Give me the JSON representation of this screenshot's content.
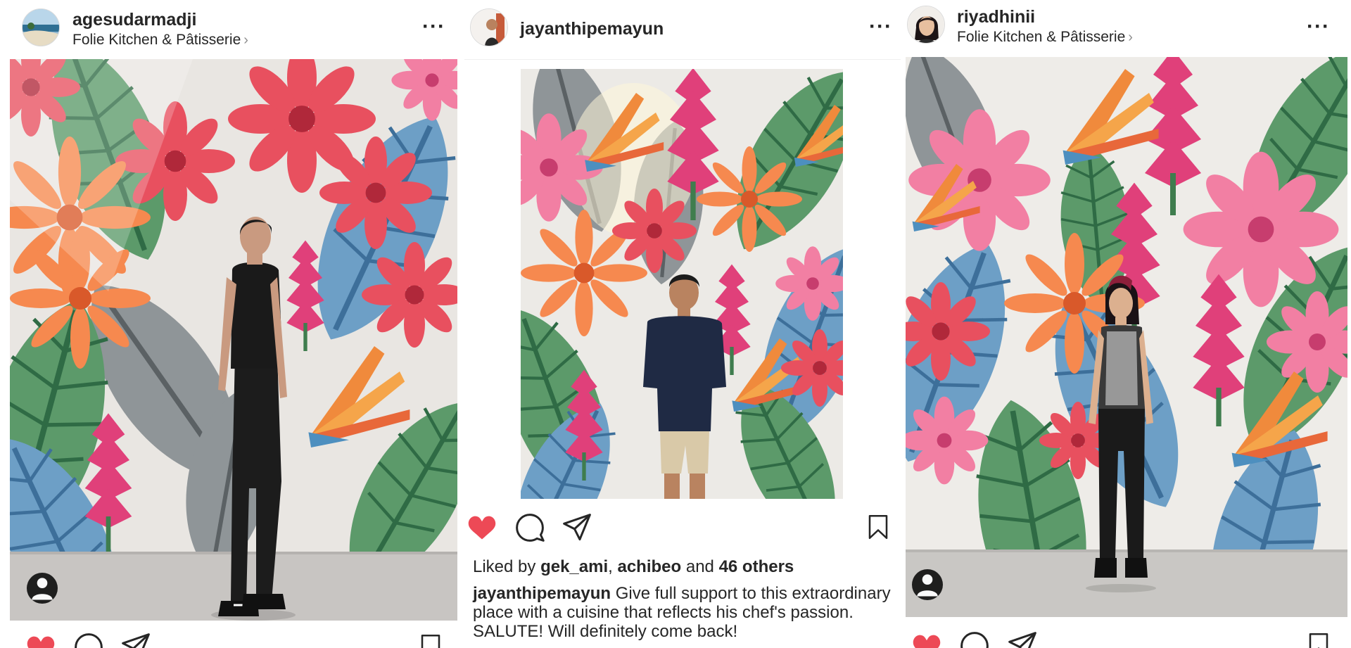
{
  "posts": [
    {
      "username": "agesudarmadji",
      "location": "Folie Kitchen & Pâtisserie",
      "more": "···",
      "liked": true
    },
    {
      "username": "jayanthipemayun",
      "more": "···",
      "liked": true,
      "likes": {
        "prefix": "Liked by",
        "user1": "gek_ami",
        "separator": ",",
        "user2": "achibeo",
        "conjunction": "and",
        "others": "46 others"
      },
      "caption": {
        "username": "jayanthipemayun",
        "text": "Give full support to this extraordinary place with a cuisine that reflects his chef's passion. SALUTE! Will definitely come back!"
      }
    },
    {
      "username": "riyadhinii",
      "location": "Folie Kitchen & Pâtisserie",
      "more": "···",
      "liked": true
    }
  ],
  "icons": {
    "like": "heart-icon",
    "comment": "comment-icon",
    "share": "paper-plane-icon",
    "save": "bookmark-icon",
    "tag": "person-tag-icon",
    "location_chevron": "chevron-right-icon"
  },
  "colors": {
    "like_red": "#ed4956",
    "text": "#262626",
    "muted": "#8e8e8e",
    "divider": "#efefef"
  }
}
